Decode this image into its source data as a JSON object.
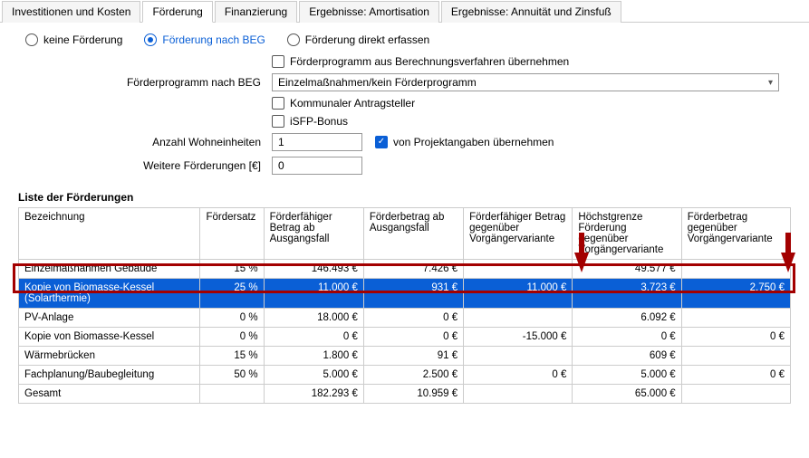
{
  "tabs": {
    "t0": "Investitionen und Kosten",
    "t1": "Förderung",
    "t2": "Finanzierung",
    "t3": "Ergebnisse: Amortisation",
    "t4": "Ergebnisse: Annuität und Zinsfuß"
  },
  "radios": {
    "r0": "keine Förderung",
    "r1": "Förderung nach BEG",
    "r2": "Förderung direkt erfassen"
  },
  "form": {
    "chk_prog": "Förderprogramm aus Berechnungsverfahren übernehmen",
    "lbl_prog": "Förderprogramm nach BEG",
    "sel_prog": "Einzelmaßnahmen/kein Förderprogramm",
    "chk_komm": "Kommunaler Antragsteller",
    "chk_isfp": "iSFP-Bonus",
    "lbl_wohn": "Anzahl Wohneinheiten",
    "val_wohn": "1",
    "chk_proj": "von Projektangaben übernehmen",
    "lbl_weitere": "Weitere Förderungen [€]",
    "val_weitere": "0"
  },
  "list_title": "Liste der Förderungen",
  "cols": {
    "c0": "Bezeichnung",
    "c1": "Fördersatz",
    "c2": "Förderfähiger Betrag ab Ausgangsfall",
    "c3": "Förderbetrag ab Ausgangsfall",
    "c4": "Förderfähiger Betrag gegenüber Vorgängervariante",
    "c5": "Höchstgrenze Förderung gegenüber Vorgängervariante",
    "c6": "Förderbetrag gegenüber Vorgängervariante"
  },
  "rows": [
    {
      "c0": "Einzelmaßnahmen Gebäude",
      "c1": "15 %",
      "c2": "146.493 €",
      "c3": "7.426 €",
      "c4": "",
      "c5": "49.577 €",
      "c6": ""
    },
    {
      "c0": "Kopie von Biomasse-Kessel (Solarthermie)",
      "c1": "25 %",
      "c2": "11.000 €",
      "c3": "931 €",
      "c4": "11.000 €",
      "c5": "3.723 €",
      "c6": "2.750 €"
    },
    {
      "c0": "PV-Anlage",
      "c1": "0 %",
      "c2": "18.000 €",
      "c3": "0 €",
      "c4": "",
      "c5": "6.092 €",
      "c6": ""
    },
    {
      "c0": "Kopie von Biomasse-Kessel",
      "c1": "0 %",
      "c2": "0 €",
      "c3": "0 €",
      "c4": "-15.000 €",
      "c5": "0 €",
      "c6": "0 €"
    },
    {
      "c0": "Wärmebrücken",
      "c1": "15 %",
      "c2": "1.800 €",
      "c3": "91 €",
      "c4": "",
      "c5": "609 €",
      "c6": ""
    },
    {
      "c0": "Fachplanung/Baubegleitung",
      "c1": "50 %",
      "c2": "5.000 €",
      "c3": "2.500 €",
      "c4": "0 €",
      "c5": "5.000 €",
      "c6": "0 €"
    },
    {
      "c0": "Gesamt",
      "c1": "",
      "c2": "182.293 €",
      "c3": "10.959 €",
      "c4": "",
      "c5": "65.000 €",
      "c6": ""
    }
  ]
}
